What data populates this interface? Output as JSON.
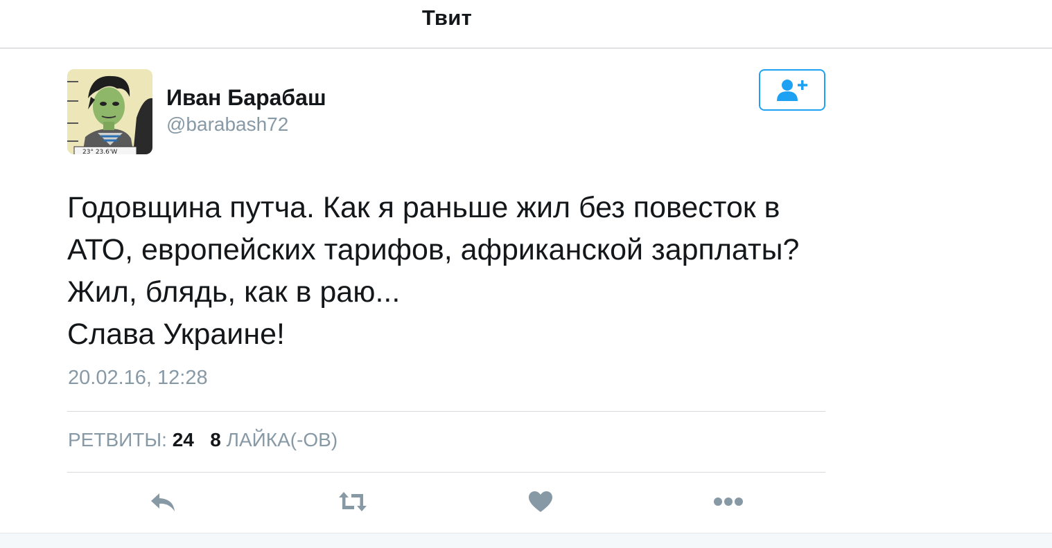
{
  "nav": {
    "title": "Твит"
  },
  "tweet": {
    "author": {
      "name": "Иван Барабаш",
      "handle": "@barabash72",
      "avatar_caption": "23° 23.6'W"
    },
    "text_lines": [
      "Годовщина путча. Как я раньше жил без повесток в",
      "АТО, европейских тарифов, африканской зарплаты?",
      "Жил, блядь, как в раю...",
      "Слава Украине!"
    ],
    "timestamp": "20.02.16, 12:28",
    "stats": {
      "retweets_label": "РЕТВИТЫ:",
      "retweets_count": "24",
      "likes_count": "8",
      "likes_label": "ЛАЙКА(-ОВ)"
    }
  },
  "actions": {
    "follow": "add-user-icon",
    "reply": "reply-icon",
    "retweet": "retweet-icon",
    "like": "heart-icon",
    "more": "more-icon"
  },
  "colors": {
    "accent": "#1da1f2",
    "icon_gray": "#8899a6",
    "text": "#14171a",
    "muted": "#8899a6"
  }
}
